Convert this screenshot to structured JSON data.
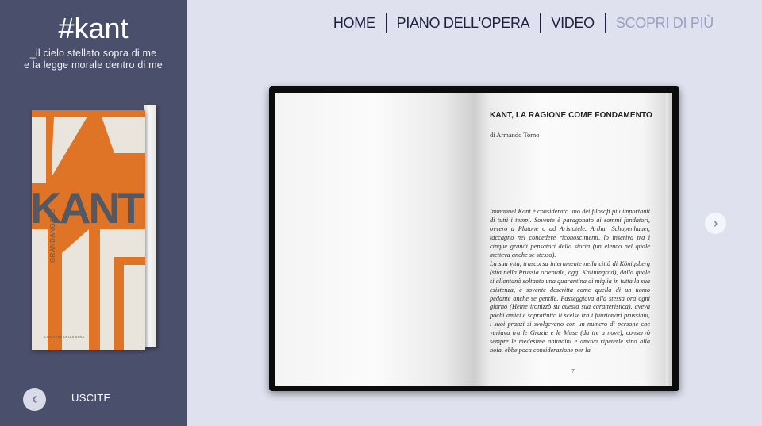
{
  "sidebar": {
    "brand": "#kant",
    "tagline": [
      "_il cielo stellato sopra di me",
      "e la legge morale dentro di me"
    ],
    "cover": {
      "title": "KANT",
      "series": "GRANDANGOLO",
      "publisher": "CORRIERE DELLA SERA",
      "colors": {
        "background": "#df7426",
        "shapes": "#e9e5dd",
        "title": "#555861"
      }
    },
    "prev_icon": "chevron-left-icon",
    "uscite_label": "USCITE"
  },
  "nav": {
    "items": [
      {
        "label": "HOME"
      },
      {
        "label": "PIANO DELL'OPERA"
      },
      {
        "label": "VIDEO"
      },
      {
        "label": "SCOPRI DI PIÙ",
        "muted": true
      }
    ]
  },
  "book": {
    "chapter_title": "KANT, LA RAGIONE COME FONDAMENTO",
    "author": "di Armando Torno",
    "paragraphs": [
      "Immanuel Kant è considerato uno dei filosofi più importanti di tutti i tempi. Sovente è paragonato ai sommi fondatori, ovvero a Platone o ad Aristotele. Arthur Schopenhauer, taccagno nel concedere riconoscimenti, lo inseriva tra i cinque grandi pensatori della storia (un elenco nel quale metteva anche se stesso).",
      "La sua vita, trascorsa interamente nella città di Königsberg (sita nella Prussia orientale, oggi Kaliningrad), dalla quale si allontanò soltanto una quarantina di miglia in tutta la sua esistenza, è sovente descritta come quella di un uomo pedante anche se gentile. Passeggiava alla stessa ora ogni giorno (Heine ironizzò su questa sua caratteristica), aveva pochi amici e soprattutto li scelse tra i funzionari prussiani, i suoi pranzi si svolgevano con un numero di persone che variava tra le Grazie e le Muse (da tre a nove), conservò sempre le medesime abitudini e amava ripeterle sino alla noia, ebbe poca considerazione per la"
    ],
    "page_number": "7",
    "next_icon": "chevron-right-icon"
  },
  "colors": {
    "sidebar": "#4a4f6c",
    "background": "#dfe1ef",
    "nav_text": "#1f2140",
    "nav_muted": "#9aa0c4"
  }
}
